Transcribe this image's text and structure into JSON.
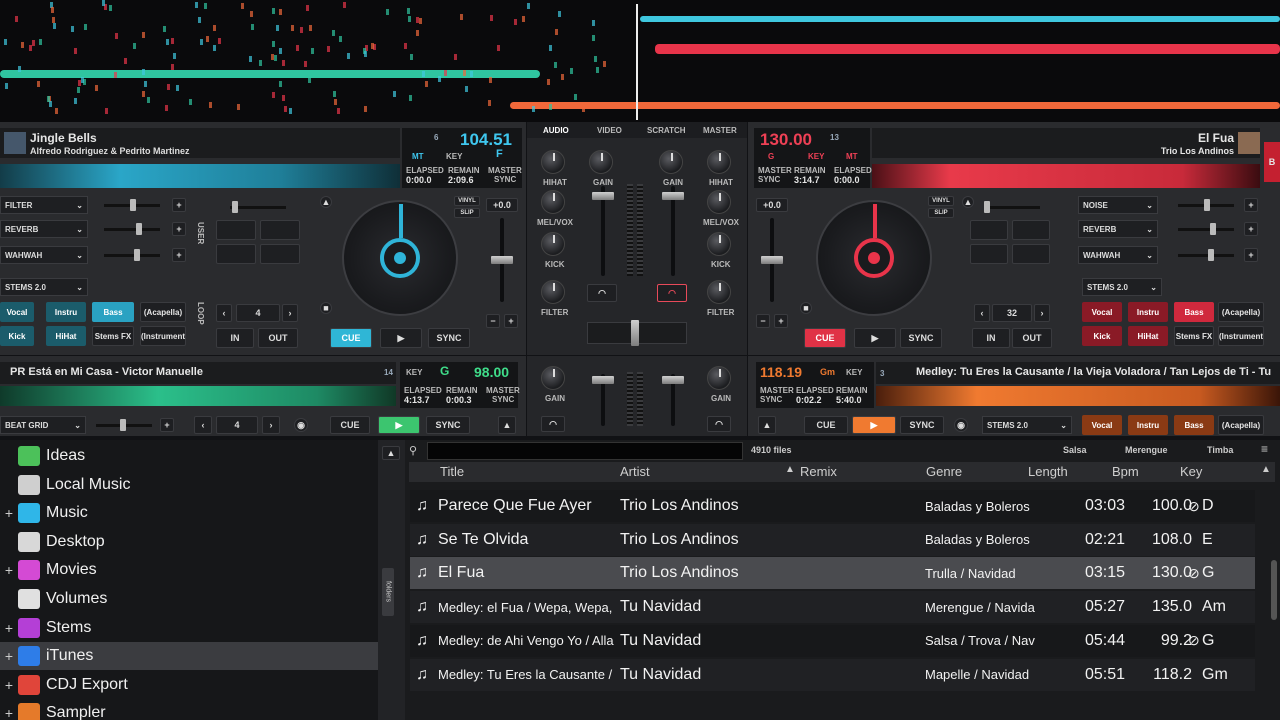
{
  "deckA": {
    "title": "Jingle Bells",
    "artist": "Alfredo Rodriguez & Pedrito Martinez",
    "deck_num": "6",
    "bpm": "104.51",
    "mt": "MT",
    "key_label": "KEY",
    "key": "F",
    "elapsed_label": "ELAPSED",
    "elapsed": "0:00.0",
    "remain_label": "REMAIN",
    "remain": "2:09.6",
    "master_label": "MASTER",
    "sync_label": "SYNC",
    "fx": [
      "FILTER",
      "REVERB",
      "WAHWAH"
    ],
    "stems_label": "STEMS 2.0",
    "stems": [
      "Vocal",
      "Instru",
      "Bass",
      "(Acapella)",
      "Kick",
      "HiHat",
      "Stems FX",
      "(Instrument"
    ],
    "loop_size": "4",
    "in": "IN",
    "out": "OUT",
    "cue": "CUE",
    "sync": "SYNC",
    "vinyl": "VINYL",
    "slip": "SLIP",
    "pitch": "+0.0",
    "user": "USER",
    "loop": "LOOP"
  },
  "deckB": {
    "title": "El Fua",
    "artist": "Trio Los Andinos",
    "deck_num": "13",
    "bpm": "130.00",
    "key_prefix": "G",
    "key_label": "KEY",
    "mt": "MT",
    "master_label": "MASTER",
    "sync_label": "SYNC",
    "remain_label": "REMAIN",
    "remain": "3:14.7",
    "elapsed_label": "ELAPSED",
    "elapsed": "0:00.0",
    "fx": [
      "NOISE",
      "REVERB",
      "WAHWAH"
    ],
    "stems_label": "STEMS 2.0",
    "stems": [
      "Vocal",
      "Instru",
      "Bass",
      "(Acapella)",
      "Kick",
      "HiHat",
      "Stems FX",
      "(Instrument"
    ],
    "loop_size": "32",
    "in": "IN",
    "out": "OUT",
    "cue": "CUE",
    "sync": "SYNC",
    "vinyl": "VINYL",
    "slip": "SLIP",
    "pitch": "+0.0",
    "side_badge": "B"
  },
  "mixer": {
    "tabs": [
      "AUDIO",
      "VIDEO",
      "SCRATCH",
      "MASTER"
    ],
    "labels": {
      "gain": "GAIN",
      "hihat": "HIHAT",
      "melvox": "MEL/VOX",
      "kick": "KICK",
      "filter": "FILTER"
    }
  },
  "deckC": {
    "title": "PR Está en Mi Casa - Victor Manuelle",
    "deck_num": "14",
    "key_label": "KEY",
    "key": "G",
    "bpm": "98.00",
    "elapsed_label": "ELAPSED",
    "elapsed": "4:13.7",
    "remain_label": "REMAIN",
    "remain": "0:00.3",
    "master_label": "MASTER",
    "sync_label": "SYNC",
    "beatgrid": "BEAT GRID",
    "loop_size": "4",
    "cue": "CUE",
    "sync": "SYNC"
  },
  "deckD": {
    "bpm": "118.19",
    "key_val": "Gm",
    "key_label": "KEY",
    "deck_num": "3",
    "title": "Medley: Tu Eres la Causante / la Vieja Voladora / Tan Lejos de Ti - Tu",
    "master_label": "MASTER",
    "sync_label": "SYNC",
    "elapsed_label": "ELAPSED",
    "elapsed": "0:02.2",
    "remain_label": "REMAIN",
    "remain": "5:40.0",
    "cue": "CUE",
    "sync": "SYNC",
    "stems_label": "STEMS 2.0",
    "stems": [
      "Vocal",
      "Instru",
      "Bass",
      "(Acapella)"
    ],
    "gain": "GAIN"
  },
  "browser": {
    "file_count": "4910 files",
    "quick_filters": [
      "Salsa",
      "Merengue",
      "Timba"
    ],
    "columns": [
      "Title",
      "Artist",
      "Remix",
      "Genre",
      "Length",
      "Bpm",
      "Key"
    ],
    "side_tab": "folders",
    "sidebar": [
      {
        "label": "Ideas",
        "icon": "lightbulb-icon",
        "color": "#4cc15a",
        "expand": ""
      },
      {
        "label": "Local Music",
        "icon": "drive-icon",
        "color": "#cfcfcf",
        "expand": ""
      },
      {
        "label": "Music",
        "icon": "music-folder-icon",
        "color": "#2fb6e8",
        "expand": "+"
      },
      {
        "label": "Desktop",
        "icon": "desktop-icon",
        "color": "#d8d8d8",
        "expand": ""
      },
      {
        "label": "Movies",
        "icon": "movies-icon",
        "color": "#d44ad4",
        "expand": "+"
      },
      {
        "label": "Volumes",
        "icon": "volumes-icon",
        "color": "#e0e0e0",
        "expand": ""
      },
      {
        "label": "Stems",
        "icon": "stems-icon",
        "color": "#b43fd6",
        "expand": "+"
      },
      {
        "label": "iTunes",
        "icon": "itunes-icon",
        "color": "#2e7de8",
        "expand": "+"
      },
      {
        "label": "CDJ Export",
        "icon": "cdj-icon",
        "color": "#e0453a",
        "expand": "+"
      },
      {
        "label": "Sampler",
        "icon": "sampler-icon",
        "color": "#e57a2a",
        "expand": "+"
      }
    ],
    "rows": [
      {
        "title": "Parece Que Fue Ayer",
        "artist": "Trio Los Andinos",
        "remix": "",
        "genre": "Baladas y Boleros",
        "length": "03:03",
        "bpm": "100.0",
        "key": "D"
      },
      {
        "title": "Se Te Olvida",
        "artist": "Trio Los Andinos",
        "remix": "",
        "genre": "Baladas y Boleros",
        "length": "02:21",
        "bpm": "108.0",
        "key": "E"
      },
      {
        "title": "El Fua",
        "artist": "Trio Los Andinos",
        "remix": "",
        "genre": "Trulla / Navidad",
        "length": "03:15",
        "bpm": "130.0",
        "key": "G"
      },
      {
        "title": "Medley: el Fua / Wepa, Wepa, We",
        "artist": "Tu Navidad",
        "remix": "",
        "genre": "Merengue / Navida",
        "length": "05:27",
        "bpm": "135.0",
        "key": "Am"
      },
      {
        "title": "Medley: de Ahi Vengo Yo / Alla en",
        "artist": "Tu Navidad",
        "remix": "",
        "genre": "Salsa / Trova / Nav",
        "length": "05:44",
        "bpm": "99.2",
        "key": "G"
      },
      {
        "title": "Medley: Tu Eres la Causante / la \\",
        "artist": "Tu Navidad",
        "remix": "",
        "genre": "Mapelle / Navidad",
        "length": "05:51",
        "bpm": "118.2",
        "key": "Gm"
      }
    ]
  }
}
